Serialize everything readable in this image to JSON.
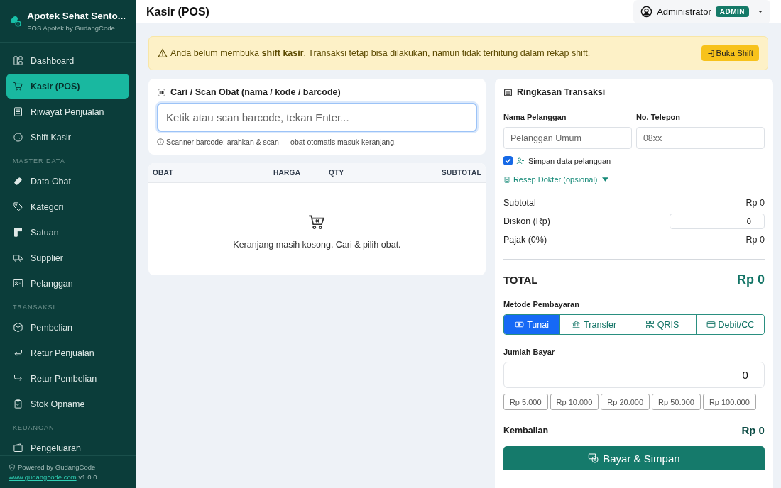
{
  "brand": {
    "title": "Apotek Sehat Sento...",
    "subtitle": "POS Apotek by GudangCode"
  },
  "sidebar": {
    "sections": [
      {
        "items": [
          {
            "label": "Dashboard",
            "selected": false
          },
          {
            "label": "Kasir (POS)",
            "selected": true
          },
          {
            "label": "Riwayat Penjualan",
            "selected": false
          },
          {
            "label": "Shift Kasir",
            "selected": false
          }
        ]
      },
      {
        "heading": "MASTER DATA",
        "items": [
          {
            "label": "Data Obat",
            "selected": false
          },
          {
            "label": "Kategori",
            "selected": false
          },
          {
            "label": "Satuan",
            "selected": false
          },
          {
            "label": "Supplier",
            "selected": false
          },
          {
            "label": "Pelanggan",
            "selected": false
          }
        ]
      },
      {
        "heading": "TRANSAKSI",
        "items": [
          {
            "label": "Pembelian",
            "selected": false
          },
          {
            "label": "Retur Penjualan",
            "selected": false
          },
          {
            "label": "Retur Pembelian",
            "selected": false
          },
          {
            "label": "Stok Opname",
            "selected": false
          }
        ]
      },
      {
        "heading": "KEUANGAN",
        "items": [
          {
            "label": "Pengeluaran",
            "selected": false
          }
        ]
      }
    ]
  },
  "footer": {
    "powered": "Powered by GudangCode",
    "link": "www.gudangcode.com",
    "version": "v1.0.0"
  },
  "header": {
    "title": "Kasir (POS)",
    "user": "Administrator",
    "role": "ADMIN"
  },
  "alert": {
    "text": "Anda belum membuka **shift kasir**. Transaksi tetap bisa dilakukan, namun tidak terhitung dalam rekap shift.",
    "button": "Buka Shift"
  },
  "search": {
    "label": "Cari / Scan Obat (nama / kode / barcode)",
    "placeholder": "Ketik atau scan barcode, tekan Enter...",
    "hint": "Scanner barcode: arahkan & scan — obat otomatis masuk keranjang."
  },
  "cart": {
    "columns": [
      "OBAT",
      "HARGA",
      "QTY",
      "SUBTOTAL"
    ],
    "empty": "Keranjang masih kosong. Cari & pilih obat."
  },
  "summary": {
    "title": "Ringkasan Transaksi",
    "customer": {
      "label": "Nama Pelanggan",
      "placeholder": "Pelanggan Umum"
    },
    "phone": {
      "label": "No. Telepon",
      "placeholder": "08xx"
    },
    "save_customer": {
      "label": "Simpan data pelanggan",
      "checked": true
    },
    "prescription": {
      "label": "Resep Dokter (opsional)"
    },
    "subtotal": {
      "label": "Subtotal",
      "value": "Rp 0"
    },
    "discount": {
      "label": "Diskon (Rp)",
      "value": "0"
    },
    "tax": {
      "label": "Pajak (0%)",
      "value": "Rp 0"
    },
    "total": {
      "label": "TOTAL",
      "value": "Rp 0"
    },
    "methods_label": "Metode Pembayaran",
    "methods": [
      {
        "label": "Tunai",
        "selected": true
      },
      {
        "label": "Transfer",
        "selected": false
      },
      {
        "label": "QRIS",
        "selected": false
      },
      {
        "label": "Debit/CC",
        "selected": false
      }
    ],
    "pay_label": "Jumlah Bayar",
    "pay_value": "0",
    "quick": [
      "Rp 5.000",
      "Rp 10.000",
      "Rp 20.000",
      "Rp 50.000",
      "Rp 100.000"
    ],
    "change": {
      "label": "Kembalian",
      "value": "Rp 0"
    },
    "submit": "Bayar & Simpan"
  }
}
